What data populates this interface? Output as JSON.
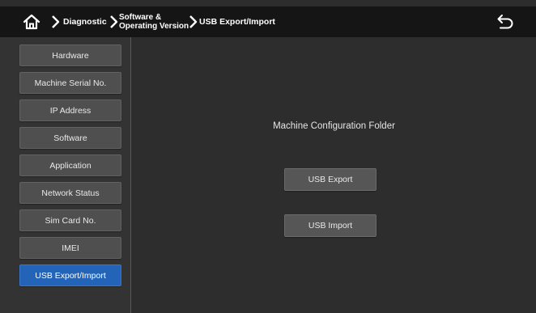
{
  "header": {
    "home_icon": "home-icon",
    "back_icon": "back-arrow-icon",
    "breadcrumbs": [
      {
        "line1": "Diagnostic",
        "line2": ""
      },
      {
        "line1": "Software &",
        "line2": "Operating Version"
      },
      {
        "line1": "USB Export/Import",
        "line2": ""
      }
    ]
  },
  "sidebar": {
    "items": [
      {
        "label": "Hardware"
      },
      {
        "label": "Machine Serial No."
      },
      {
        "label": "IP Address"
      },
      {
        "label": "Software"
      },
      {
        "label": "Application"
      },
      {
        "label": "Network Status"
      },
      {
        "label": "Sim Card No."
      },
      {
        "label": "IMEI"
      },
      {
        "label": "USB Export/Import"
      }
    ],
    "active_index": 8
  },
  "main": {
    "title": "Machine Configuration Folder",
    "export_label": "USB Export",
    "import_label": "USB Import"
  },
  "colors": {
    "header_bg": "#151515",
    "panel_bg": "#2d2d2d",
    "button_bg": "#4f4f4f",
    "active_accent": "#2363b8"
  }
}
